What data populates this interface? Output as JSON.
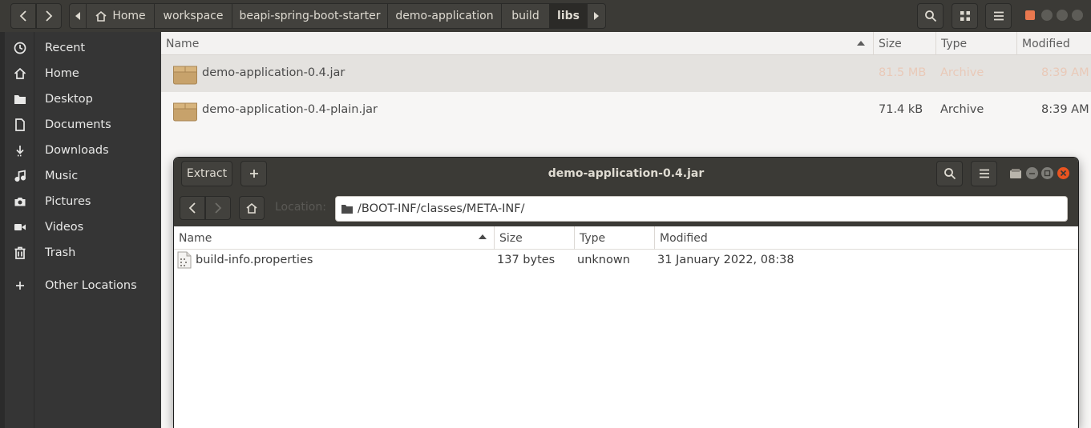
{
  "nautilus": {
    "breadcrumbs": [
      "Home",
      "workspace",
      "beapi-spring-boot-starter",
      "demo-application",
      "build",
      "libs"
    ],
    "sidebar": {
      "items": [
        {
          "label": "Recent",
          "icon": "clock-icon"
        },
        {
          "label": "Home",
          "icon": "home-icon"
        },
        {
          "label": "Desktop",
          "icon": "folder-icon"
        },
        {
          "label": "Documents",
          "icon": "document-icon"
        },
        {
          "label": "Downloads",
          "icon": "download-icon"
        },
        {
          "label": "Music",
          "icon": "music-icon"
        },
        {
          "label": "Pictures",
          "icon": "camera-icon"
        },
        {
          "label": "Videos",
          "icon": "video-icon"
        },
        {
          "label": "Trash",
          "icon": "trash-icon"
        },
        {
          "label": "Other Locations",
          "icon": "plus-icon"
        }
      ]
    },
    "columns": {
      "name": "Name",
      "size": "Size",
      "type": "Type",
      "modified": "Modified"
    },
    "files": [
      {
        "name": "demo-application-0.4.jar",
        "size": "81.5 MB",
        "type": "Archive",
        "modified": "8:39 AM",
        "selected": true
      },
      {
        "name": "demo-application-0.4-plain.jar",
        "size": "71.4 kB",
        "type": "Archive",
        "modified": "8:39 AM",
        "selected": false
      }
    ]
  },
  "roller": {
    "title": "demo-application-0.4.jar",
    "extract_label": "Extract",
    "location_label": "Location:",
    "location_value": "/BOOT-INF/classes/META-INF/",
    "columns": {
      "name": "Name",
      "size": "Size",
      "type": "Type",
      "modified": "Modified"
    },
    "files": [
      {
        "name": "build-info.properties",
        "size": "137 bytes",
        "type": "unknown",
        "modified": "31 January 2022, 08:38"
      }
    ]
  },
  "colors": {
    "header_bg": "#3b3a36",
    "sidebar_bg": "#353535",
    "selection_bg": "#e4e2df",
    "close_button": "#e95420"
  }
}
